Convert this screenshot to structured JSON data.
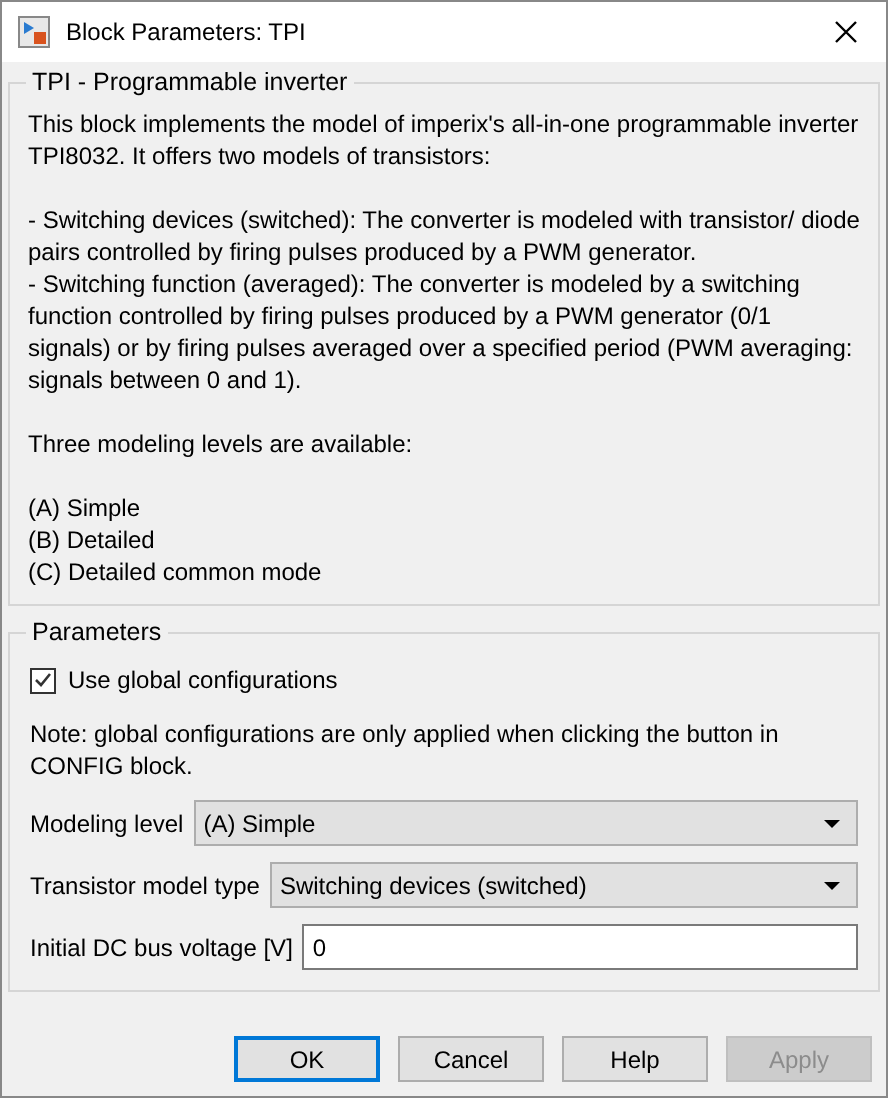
{
  "window": {
    "title": "Block Parameters: TPI"
  },
  "description": {
    "title": "TPI - Programmable inverter",
    "paragraphs": [
      [
        "This block implements the model of imperix's all-in-one programmable inverter TPI8032. It offers two models of transistors:"
      ],
      [
        "- Switching devices (switched): The converter is modeled with transistor/ diode pairs controlled by firing pulses produced by a PWM generator.",
        "- Switching function (averaged): The converter is modeled by a switching function controlled by firing pulses produced by a PWM generator (0/1 signals) or by firing pulses averaged over a specified period (PWM averaging: signals between 0 and 1)."
      ],
      [
        "Three modeling levels are available:"
      ],
      [
        "(A) Simple",
        "(B) Detailed",
        "(C) Detailed common mode"
      ]
    ]
  },
  "parameters": {
    "title": "Parameters",
    "checkbox": {
      "label": "Use global configurations",
      "checked": true
    },
    "note": "Note: global configurations are only applied when clicking the button in CONFIG block.",
    "fields": [
      {
        "kind": "dropdown",
        "label": "Modeling level",
        "value": "(A) Simple"
      },
      {
        "kind": "dropdown",
        "label": "Transistor model type",
        "value": "Switching devices (switched)"
      },
      {
        "kind": "text",
        "label": "Initial DC bus voltage [V]",
        "value": "0"
      }
    ]
  },
  "buttons": [
    {
      "label": "OK",
      "focused": true,
      "disabled": false
    },
    {
      "label": "Cancel",
      "focused": false,
      "disabled": false
    },
    {
      "label": "Help",
      "focused": false,
      "disabled": false
    },
    {
      "label": "Apply",
      "focused": false,
      "disabled": true
    }
  ]
}
